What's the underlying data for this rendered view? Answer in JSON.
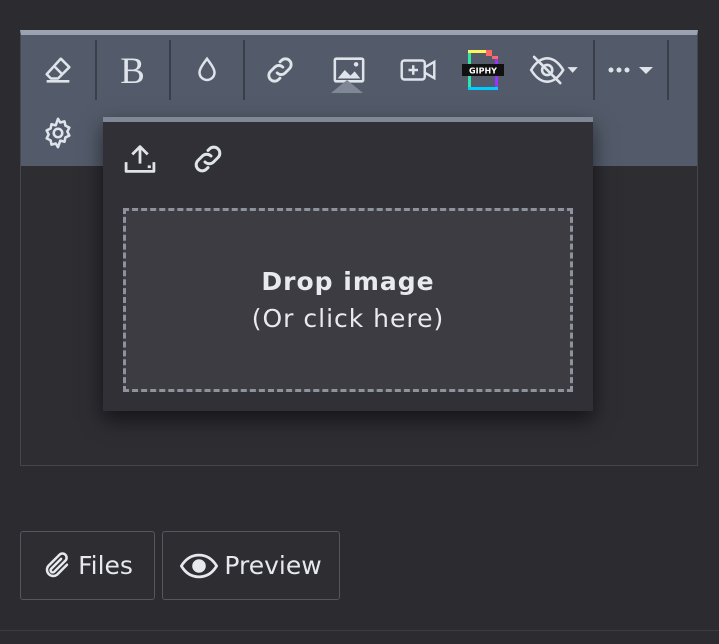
{
  "toolbar": {
    "row1": [
      {
        "name": "eraser",
        "title": "Clear formatting"
      },
      {
        "name": "bold",
        "title": "Bold"
      },
      {
        "name": "color",
        "title": "Color"
      },
      {
        "name": "link",
        "title": "Link"
      },
      {
        "name": "image",
        "title": "Image"
      },
      {
        "name": "video",
        "title": "Video"
      },
      {
        "name": "giphy",
        "title": "GIPHY"
      },
      {
        "name": "spoiler",
        "title": "Spoiler"
      },
      {
        "name": "more",
        "title": "More"
      }
    ],
    "row2": [
      {
        "name": "gear",
        "title": "Settings"
      }
    ],
    "giphy_label": "GIPHY"
  },
  "image_popup": {
    "tabs": [
      "upload",
      "link"
    ],
    "drop_title": "Drop image",
    "drop_subtitle": "(Or click here)"
  },
  "buttons": {
    "files": "Files",
    "preview": "Preview"
  },
  "colors": {
    "toolbar_bg": "#535b6a",
    "popup_bg": "#303036",
    "page_bg": "#2b2b30"
  }
}
